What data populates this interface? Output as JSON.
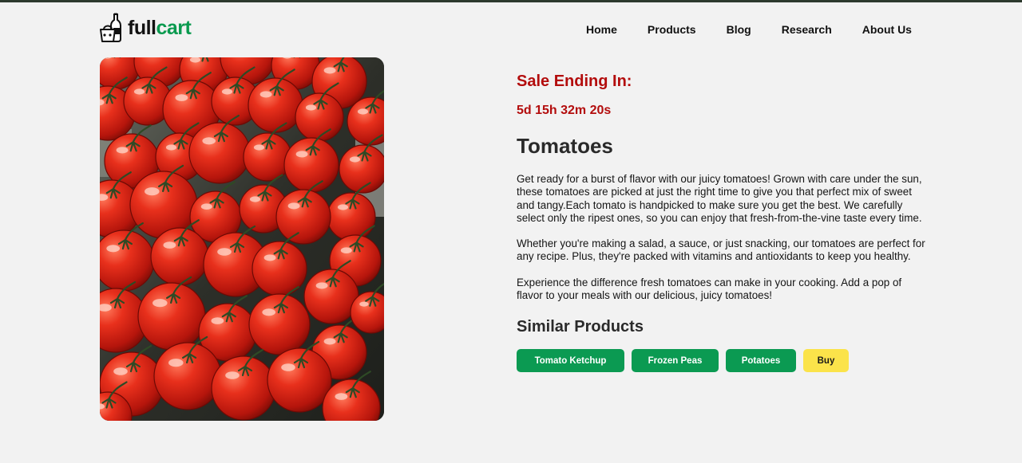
{
  "brand": {
    "name_part1": "full",
    "name_part2": "cart",
    "accent_color": "#0a9a4f",
    "icon": "grocery-basket-bottle-icon"
  },
  "nav": {
    "items": [
      {
        "label": "Home"
      },
      {
        "label": "Products"
      },
      {
        "label": "Blog"
      },
      {
        "label": "Research"
      },
      {
        "label": "About Us"
      }
    ]
  },
  "product": {
    "sale_heading": "Sale Ending In:",
    "countdown": "5d 15h 32m 20s",
    "sale_color": "#b30d0d",
    "title": "Tomatoes",
    "image_subject": "pile of red tomatoes on the vine",
    "description": [
      "Get ready for a burst of flavor with our juicy tomatoes! Grown with care under the sun, these tomatoes are picked at just the right time to give you that perfect mix of sweet and tangy.Each tomato is handpicked to make sure you get the best. We carefully select only the ripest ones, so you can enjoy that fresh-from-the-vine taste every time.",
      "Whether you're making a salad, a sauce, or just snacking, our tomatoes are perfect for any recipe. Plus, they're packed with vitamins and antioxidants to keep you healthy.",
      "Experience the difference fresh tomatoes can make in your cooking. Add a pop of flavor to your meals with our delicious, juicy tomatoes!"
    ]
  },
  "similar": {
    "heading": "Similar Products",
    "items": [
      {
        "label": "Tomato Ketchup"
      },
      {
        "label": "Frozen Peas"
      },
      {
        "label": "Potatoes"
      }
    ],
    "item_color": "#0b9a52",
    "buy_label": "Buy",
    "buy_color": "#fbe34a"
  }
}
